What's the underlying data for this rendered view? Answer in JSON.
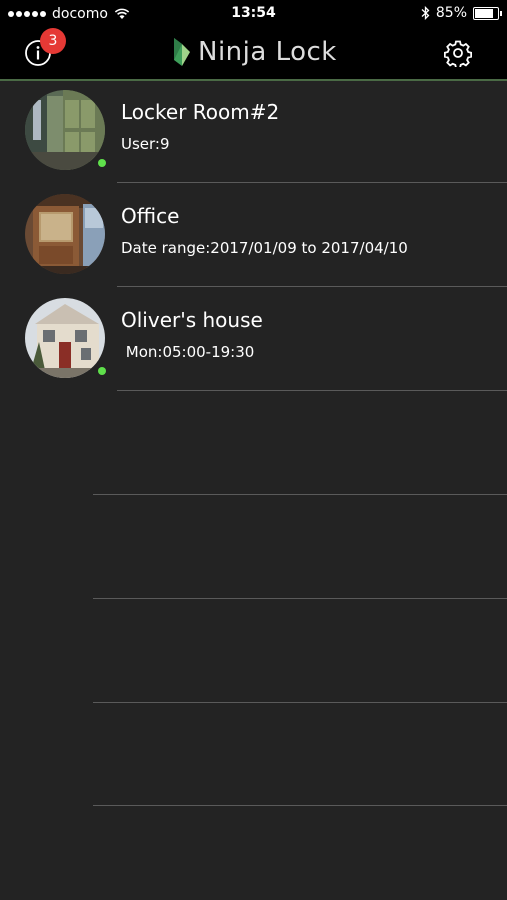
{
  "status_bar": {
    "carrier": "docomo",
    "time": "13:54",
    "battery": "85%"
  },
  "nav": {
    "app_name": "Ninja Lock",
    "info_badge_count": "3"
  },
  "locks": [
    {
      "name": "Locker Room#2",
      "detail": "User:9",
      "online": true,
      "avatar": "locker-room-photo"
    },
    {
      "name": "Office",
      "detail": "Date range:2017/01/09 to 2017/04/10",
      "online": false,
      "avatar": "office-door-photo"
    },
    {
      "name": "Oliver's house",
      "detail": " Mon:05:00-19:30",
      "online": true,
      "avatar": "house-photo"
    }
  ],
  "colors": {
    "background": "#232323",
    "online_dot": "#5fe04b",
    "badge": "#e53935",
    "accent_line": "#4a6a45"
  }
}
